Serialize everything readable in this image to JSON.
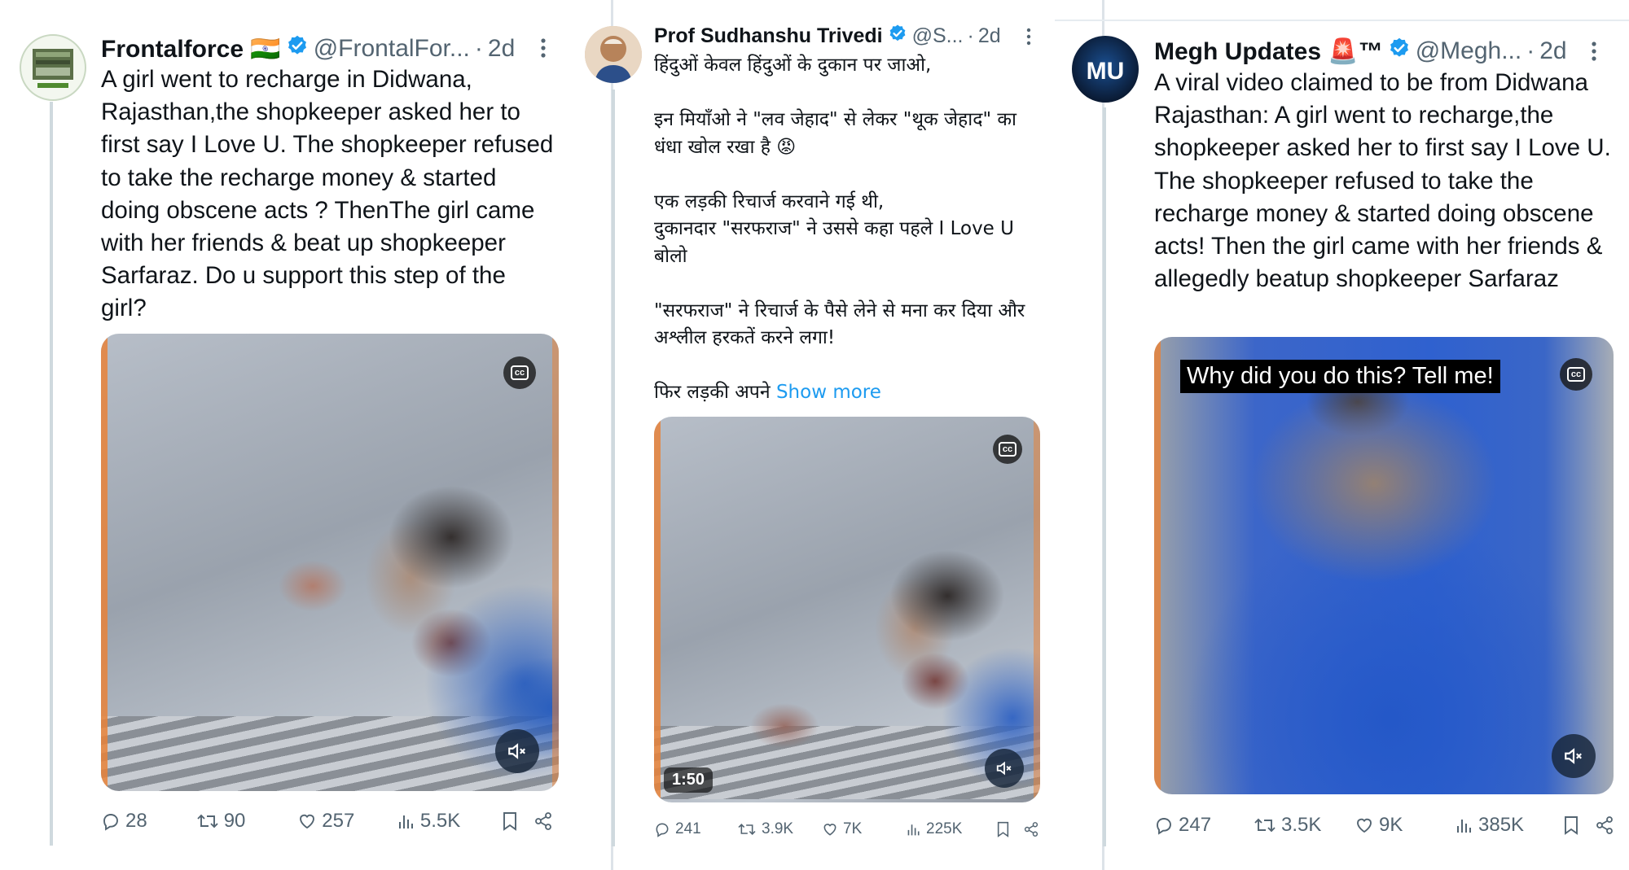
{
  "tweets": [
    {
      "name": "Frontalforce 🇮🇳",
      "handle": "@FrontalFor...",
      "dot": "·",
      "time": "2d",
      "avatar_label": "Frontal Force",
      "text": "A girl went to recharge in Didwana, Rajasthan,the shopkeeper asked her to first say I Love U. The shopkeeper refused to take the recharge money & started doing obscene acts ? ThenThe girl came with her friends & beat up shopkeeper Sarfaraz. Do u support this step of the girl?",
      "show_more": "",
      "video": {
        "cc": "cc",
        "caption": "",
        "duration": ""
      },
      "stats": {
        "replies": "28",
        "reposts": "90",
        "likes": "257",
        "views": "5.5K"
      }
    },
    {
      "name": "Prof Sudhanshu Trivedi",
      "handle": "@S...",
      "dot": "·",
      "time": "2d",
      "avatar_label": "",
      "text": "हिंदुओं केवल हिंदुओं के दुकान पर जाओ,\n\nइन मियाँओ ने \"लव जेहाद\" से लेकर \"थूक जेहाद\" का धंधा खोल रखा है 😡\n\nएक लड़की रिचार्ज करवाने गई थी,\nदुकानदार \"सरफराज\" ने उससे कहा पहले I Love U बोलो\n\n\"सरफराज\" ने रिचार्ज के पैसे लेने से मना कर दिया और अश्लील हरकतें करने लगा!\n\nफिर लड़की अपने ",
      "show_more": "Show more",
      "video": {
        "cc": "cc",
        "caption": "",
        "duration": "1:50"
      },
      "stats": {
        "replies": "241",
        "reposts": "3.9K",
        "likes": "7K",
        "views": "225K"
      }
    },
    {
      "name": "Megh Updates 🚨™",
      "handle": "@Megh...",
      "dot": "·",
      "time": "2d",
      "avatar_label": "MU",
      "text": "A viral video claimed to be from Didwana Rajasthan: A girl went to recharge,the shopkeeper asked her to first say I Love U. The shopkeeper refused to take the recharge money & started doing obscene acts! Then the girl came with her friends & allegedly beatup shopkeeper Sarfaraz",
      "show_more": "",
      "video": {
        "cc": "cc",
        "caption": "Why did you do this? Tell me!",
        "duration": ""
      },
      "stats": {
        "replies": "247",
        "reposts": "3.5K",
        "likes": "9K",
        "views": "385K"
      }
    }
  ],
  "colors": {
    "verified": "#1d9bf0",
    "link": "#1d9bf0",
    "muted_text": "#536471",
    "divider": "#dde3e8"
  },
  "icons": [
    "verified-badge-icon",
    "more-options-icon",
    "cc-icon",
    "mute-icon",
    "reply-icon",
    "repost-icon",
    "like-icon",
    "views-icon",
    "bookmark-icon",
    "share-icon"
  ]
}
